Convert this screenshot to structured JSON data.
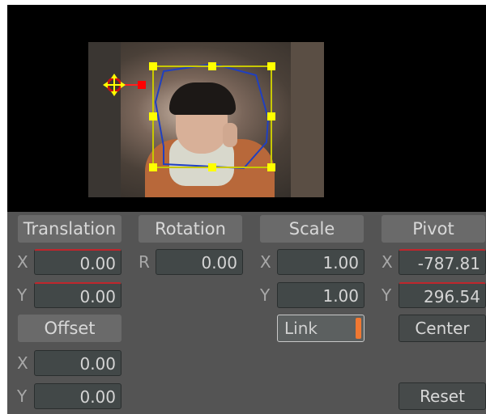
{
  "headers": {
    "translation": "Translation",
    "rotation": "Rotation",
    "scale": "Scale",
    "pivot": "Pivot",
    "offset": "Offset"
  },
  "translation": {
    "x_label": "X",
    "x": "0.00",
    "y_label": "Y",
    "y": "0.00"
  },
  "rotation": {
    "r_label": "R",
    "r": "0.00"
  },
  "scale": {
    "x_label": "X",
    "x": "1.00",
    "y_label": "Y",
    "y": "1.00",
    "link_label": "Link",
    "link_active": true
  },
  "pivot": {
    "x_label": "X",
    "x": "-787.81",
    "y_label": "Y",
    "y": "296.54",
    "center_label": "Center"
  },
  "offset": {
    "x_label": "X",
    "x": "0.00",
    "y_label": "Y",
    "y": "0.00"
  },
  "reset_label": "Reset",
  "colors": {
    "handle": "#ffff00",
    "bounding_box": "#c8c800",
    "mask_outline": "#2040c0",
    "pivot_marker": "#ff0000",
    "link_indicator": "#f07832"
  }
}
